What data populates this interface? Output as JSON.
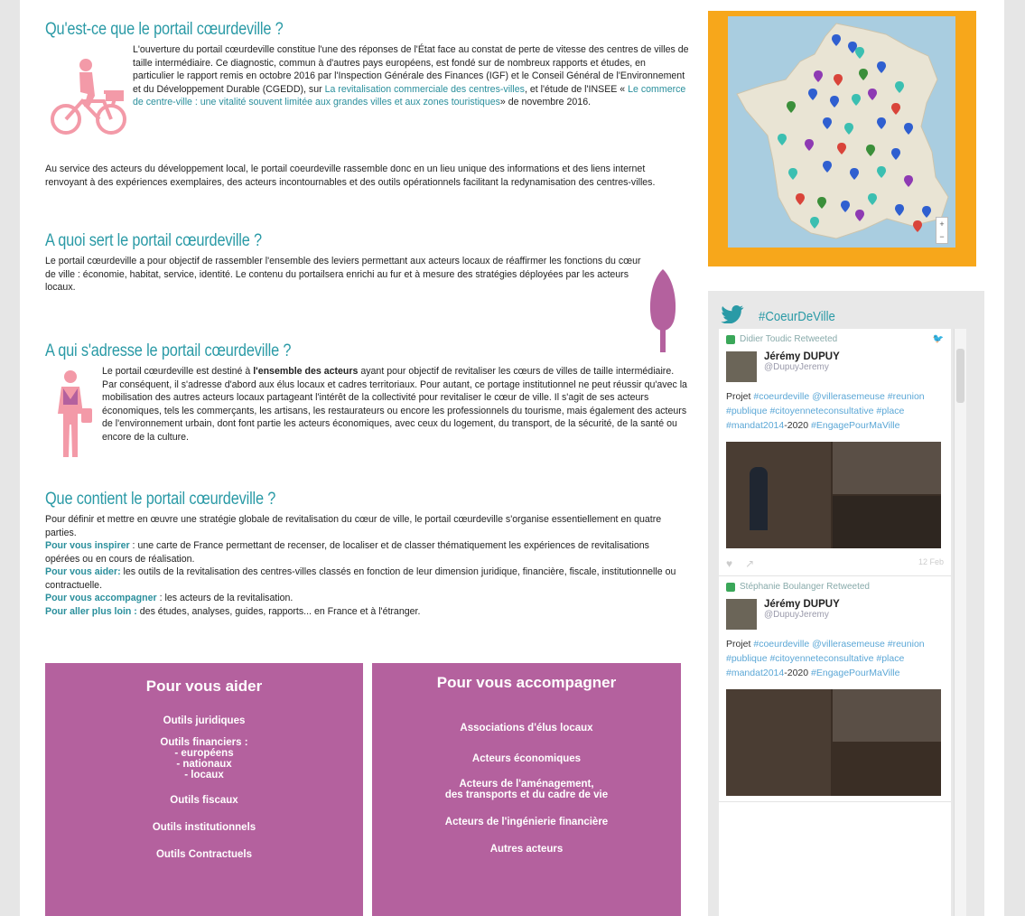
{
  "sections": {
    "s1": {
      "title": "Qu'est-ce que le portail cœurdeville ?",
      "p1_a": "L'ouverture du portail cœurdeville constitue l'une des réponses de l'État face au constat de perte de vitesse des centres de villes de taille intermédiaire. Ce diagnostic, commun à d'autres pays européens, est fondé sur de nombreux rapports et études, en particulier le rapport remis en octobre 2016 par l'Inspection Générale des Finances (IGF) et le Conseil Général de l'Environnement et du Développement Durable (CGEDD), sur ",
      "link1": "La revitalisation commerciale des centres-villes",
      "p1_b": ", et l'étude de l'INSEE « ",
      "link2": "Le commerce de centre-ville : une vitalité souvent limitée aux grandes villes et aux zones touristiques",
      "p1_c": "» de novembre 2016.",
      "p2": "Au service des acteurs du développement local, le portail coeurdeville rassemble donc en un lieu unique des informations et des liens internet renvoyant à des expériences exemplaires, des acteurs incontournables et des outils opérationnels facilitant la redynamisation des centres-villes."
    },
    "s2": {
      "title": "A quoi sert le portail cœurdeville ?",
      "p": "Le portail cœurdeville a pour objectif de rassembler l'ensemble des leviers permettant aux acteurs locaux de réaffirmer les fonctions du cœur de ville : économie, habitat, service, identité. Le contenu du portailsera enrichi au fur et à mesure des stratégies déployées par les acteurs locaux."
    },
    "s3": {
      "title": "A qui s'adresse le portail cœurdeville ?",
      "p_a": "Le portail cœurdeville est destiné à ",
      "p_bold": "l'ensemble des acteurs",
      "p_b": " ayant pour objectif de revitaliser les cœurs de villes de taille intermédiaire. Par conséquent, il s'adresse d'abord aux élus locaux et cadres territoriaux. Pour autant, ce portage institutionnel ne peut réussir qu'avec la mobilisation des autres acteurs locaux partageant l'intérêt de la collectivité pour revitaliser le cœur de ville. Il s'agit de ses acteurs économiques, tels les commerçants, les artisans, les restaurateurs ou encore les professionnels du tourisme, mais également des acteurs de l'environnement urbain, dont font partie les acteurs économiques, avec ceux du logement, du transport, de la sécurité, de la santé ou encore de la culture."
    },
    "s4": {
      "title": "Que contient le portail cœurdeville ?",
      "intro": "Pour définir et mettre en œuvre une stratégie globale de revitalisation du cœur de ville, le portail cœurdeville s'organise essentiellement en quatre parties.",
      "l1": "Pour vous inspirer",
      "t1": " : une carte de France permettant de recenser, de localiser et de classer thématiquement les expériences de revitalisations opérées ou en cours de réalisation.",
      "l2": "Pour vous aider:",
      "t2": " les outils de la revitalisation des centres-villes classés en fonction de leur dimension juridique, financière, fiscale, institutionnelle ou contractuelle.",
      "l3": "Pour vous accompagner",
      "t3": " : les acteurs de la revitalisation.",
      "l4": "Pour aller plus loin :",
      "t4": " des études, analyses, guides, rapports... en France et à l'étranger."
    }
  },
  "box_aider": {
    "title": "Pour vous aider",
    "links": [
      "Outils juridiques",
      "Outils financiers :",
      "- européens",
      "- nationaux",
      "- locaux",
      "Outils fiscaux",
      "Outils institutionnels",
      "Outils Contractuels"
    ]
  },
  "box_accompagner": {
    "title": "Pour vous accompagner",
    "links": [
      "Associations d'élus locaux",
      "Acteurs économiques",
      "Acteurs de l'aménagement,",
      "des transports et du cadre de vie",
      "Acteurs de l'ingénierie financière",
      "Autres acteurs"
    ]
  },
  "twitter": {
    "hashtag": "#CoeurDeVille",
    "tweets": [
      {
        "retweeter": "Didier Toudic Retweeted",
        "name": "Jérémy DUPUY",
        "handle": "@DupuyJeremy",
        "body_a": "Projet ",
        "tags1": "#coeurdeville @villerasemeuse #reunion #publique #citoyenneteconsultative #place #mandat2014",
        "body_b": "-2020 ",
        "tags2": "#EngagePourMaVille",
        "time": "12 Feb"
      },
      {
        "retweeter": "Stéphanie Boulanger Retweeted",
        "name": "Jérémy DUPUY",
        "handle": "@DupuyJeremy",
        "body_a": "Projet ",
        "tags1": "#coeurdeville @villerasemeuse #reunion #publique #citoyenneteconsultative #place #mandat2014",
        "body_b": "-2020 ",
        "tags2": "#EngagePourMaVille"
      }
    ]
  },
  "colors": {
    "teal": "#2a9aa6",
    "magenta": "#b4619e",
    "orange": "#f7a71b",
    "pink_icon": "#f39aa8"
  },
  "map": {
    "zoom_in": "+",
    "zoom_out": "−"
  }
}
